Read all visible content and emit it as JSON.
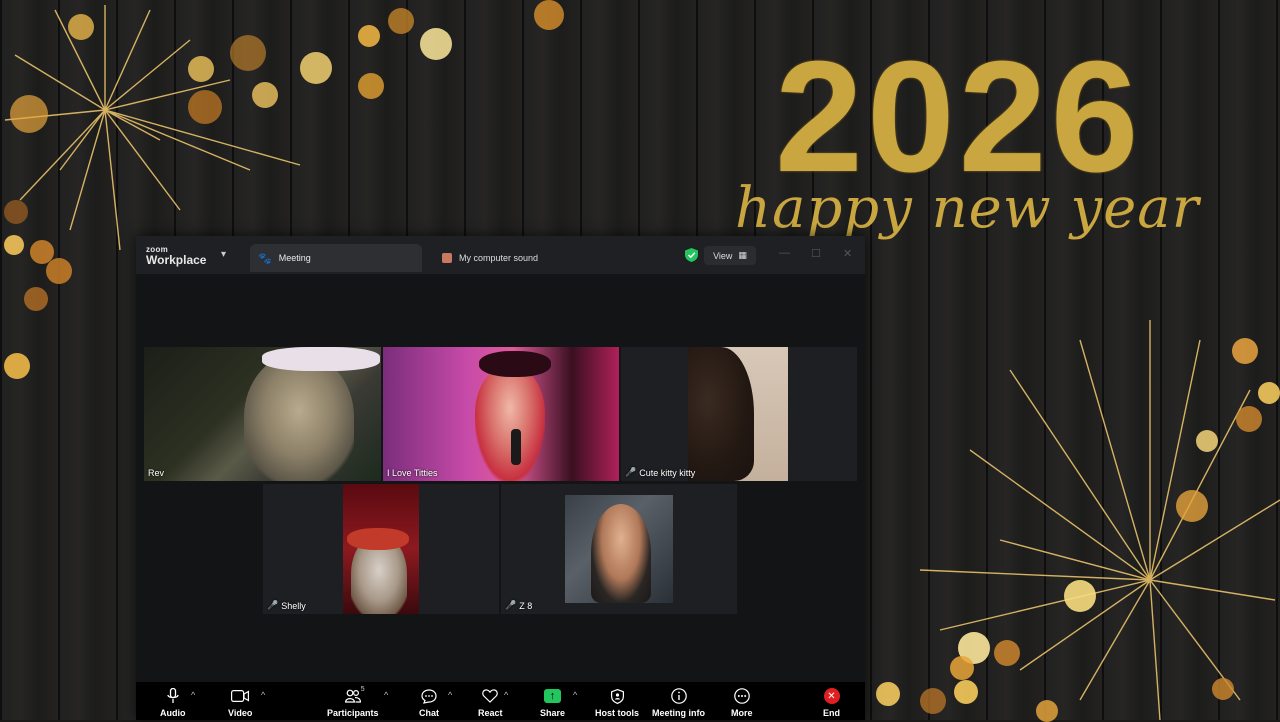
{
  "background": {
    "year": "2026",
    "greeting": "happy new year",
    "accent_color": "#c9a640"
  },
  "window": {
    "brand_small": "zoom",
    "brand_big": "Workplace",
    "tabs": [
      {
        "label": "Meeting",
        "icon": "paw-icon"
      },
      {
        "label": "My computer sound",
        "icon": "speaker-icon"
      }
    ],
    "view_label": "View"
  },
  "participants": [
    {
      "name": "Rev",
      "muted": false,
      "speaking": true
    },
    {
      "name": "I Love Titties",
      "muted": false,
      "speaking": false
    },
    {
      "name": "Cute kitty kitty",
      "muted": true,
      "speaking": false
    },
    {
      "name": "Shelly",
      "muted": true,
      "speaking": false
    },
    {
      "name": "Z 8",
      "muted": true,
      "speaking": false
    },
    {
      "name": "",
      "muted": false,
      "speaking": false
    }
  ],
  "toolbar": {
    "audio": "Audio",
    "video": "Video",
    "participants": "Participants",
    "participants_count": "5",
    "chat": "Chat",
    "react": "React",
    "share": "Share",
    "host_tools": "Host tools",
    "meeting_info": "Meeting info",
    "more": "More",
    "end": "End"
  },
  "colors": {
    "speaking_border": "#2fdb8c",
    "share_green": "#22c55e",
    "end_red": "#e02020"
  }
}
